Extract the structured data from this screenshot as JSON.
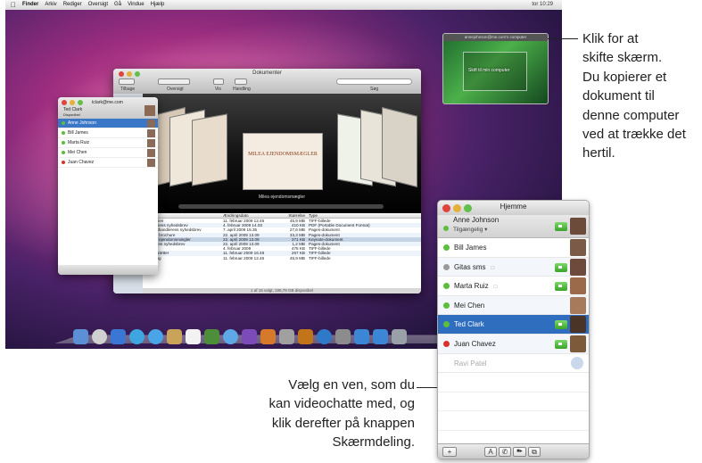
{
  "menubar": {
    "apple": "",
    "items": [
      "Finder",
      "Arkiv",
      "Rediger",
      "Oversigt",
      "Gå",
      "Vindue",
      "Hjælp"
    ],
    "clock": "tor 10:29"
  },
  "finder": {
    "title": "Dokumenter",
    "toolbar": {
      "back": "Tilbage",
      "view": "Oversigt",
      "show": "Vis",
      "action": "Handling",
      "search": "Søg"
    },
    "coverflow_doc": "MILEA EJENDOMSMÆGLER",
    "coverflow_caption": "Milea ejendomsmægler",
    "columns": [
      "Navn",
      "Ændringsdato",
      "Størrelse",
      "Type"
    ],
    "rows": [
      [
        "Familien",
        "11. februar 2009 12.46",
        "45,9 MB",
        "TIFF-billede"
      ],
      [
        "Familiens nyhedsbrev",
        "4. februar 2009 14.03",
        "410 KB",
        "PDF (Portable Document Format)"
      ],
      [
        "Grønthandlerens nyhedsbrev",
        "7. april 2009 15.35",
        "27,6 MB",
        "Pages-dokument"
      ],
      [
        "Milea brochure",
        "22. april 2009 13.09",
        "33,3 MB",
        "Pages-dokument"
      ],
      [
        "Milea ejendomsmægler",
        "22. april 2009 13.09",
        "371 KB",
        "Keynote-dokument"
      ],
      [
        "Skolens nyhedsbrev",
        "22. april 2009 13.09",
        "1,2 MB",
        "Pages-dokument"
      ],
      [
        "Smil",
        "4. februar 2009",
        "475 KB",
        "TIFF-billede"
      ],
      [
        "Surfbrætter",
        "11. februar 2009 16.48",
        "267 KB",
        "TIFF-billede"
      ],
      [
        "Surfing",
        "11. februar 2009 12.46",
        "45,9 MB",
        "TIFF-billede"
      ]
    ],
    "status": "1 af 15 valgt, 195,79 GB disponibel"
  },
  "ichat_small": {
    "title": "tclark@me.com",
    "me": {
      "name": "Ted Clark",
      "status": "Disponibel"
    },
    "buddies": [
      {
        "name": "Anne Johnson",
        "selected": true
      },
      {
        "name": "Bill James"
      },
      {
        "name": "Marta Ruiz"
      },
      {
        "name": "Mei Chen"
      },
      {
        "name": "Juan Chavez"
      }
    ]
  },
  "screen_thumb": {
    "title": "annejohnson@me.com's computer",
    "label": "Skift til min computer"
  },
  "callouts": {
    "top": [
      "Klik for at",
      "skifte skærm.",
      "Du kopierer et",
      "dokument til",
      "denne computer",
      "ved at trække det",
      "hertil."
    ],
    "bottom": [
      "Vælg en ven, som du",
      "kan videochatte med, og",
      "klik derefter på knappen",
      "Skærmdeling."
    ]
  },
  "ichat": {
    "title": "Hjemme",
    "me": {
      "name": "Anne Johnson",
      "status": "Tilgængelig ▾"
    },
    "buddies": [
      {
        "name": "Bill James",
        "status_color": "#5bbf3a",
        "camera": false,
        "alt": false
      },
      {
        "name": "Gitas sms",
        "status_color": "#9a9a9a",
        "camera": true,
        "alt": true,
        "extra": "□"
      },
      {
        "name": "Marta Ruiz",
        "status_color": "#5bbf3a",
        "camera": true,
        "alt": false,
        "extra": "□"
      },
      {
        "name": "Mei Chen",
        "status_color": "#5bbf3a",
        "camera": false,
        "alt": true
      },
      {
        "name": "Ted Clark",
        "status_color": "#5bbf3a",
        "camera": true,
        "alt": false,
        "selected": true
      },
      {
        "name": "Juan Chavez",
        "status_color": "#d9322b",
        "camera": true,
        "alt": true
      },
      {
        "name": "Ravi Patel",
        "offline": true
      }
    ],
    "footer": {
      "add": "+",
      "text": "A",
      "audio": "✆",
      "video": "■▸",
      "share": "⧉"
    }
  }
}
